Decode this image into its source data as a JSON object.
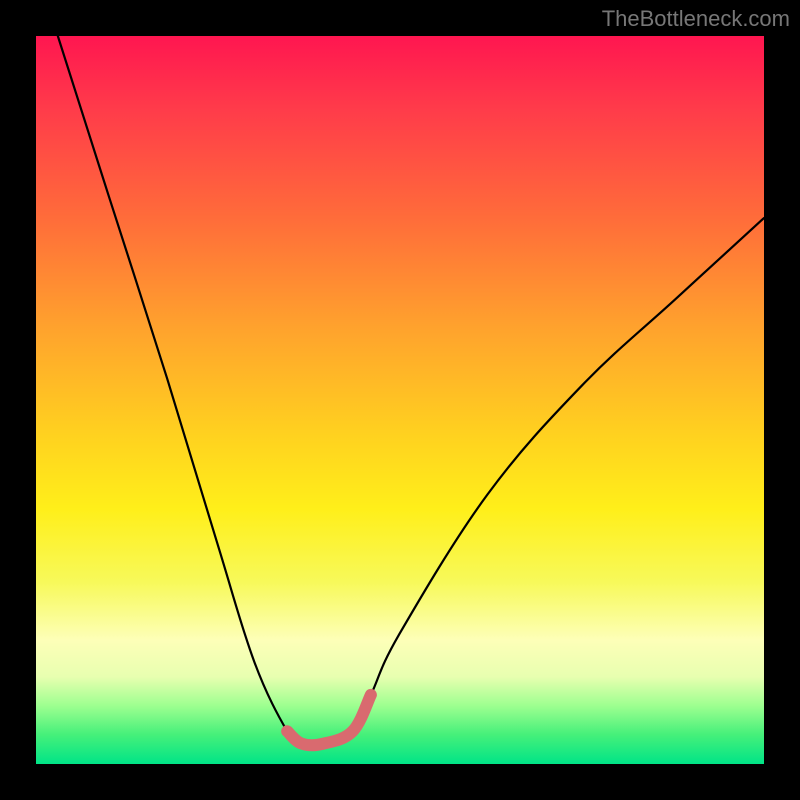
{
  "watermark": "TheBottleneck.com",
  "chart_data": {
    "type": "line",
    "title": "",
    "xlabel": "",
    "ylabel": "",
    "xlim": [
      0,
      1
    ],
    "ylim": [
      0,
      1
    ],
    "series": [
      {
        "name": "bottleneck-curve",
        "x": [
          0.03,
          0.1,
          0.18,
          0.25,
          0.3,
          0.345,
          0.365,
          0.395,
          0.435,
          0.46,
          0.5,
          0.62,
          0.75,
          0.88,
          1.0
        ],
        "y": [
          1.0,
          0.78,
          0.53,
          0.3,
          0.14,
          0.045,
          0.028,
          0.028,
          0.045,
          0.095,
          0.18,
          0.37,
          0.52,
          0.64,
          0.75
        ]
      },
      {
        "name": "bottom-highlight",
        "x": [
          0.345,
          0.365,
          0.395,
          0.435,
          0.46
        ],
        "y": [
          0.045,
          0.028,
          0.028,
          0.045,
          0.095
        ]
      }
    ],
    "colors": {
      "curve": "#000000",
      "highlight": "#d96a6f",
      "gradient_top": "#ff1650",
      "gradient_mid": "#ffd21f",
      "gradient_bottom": "#00e487"
    }
  }
}
